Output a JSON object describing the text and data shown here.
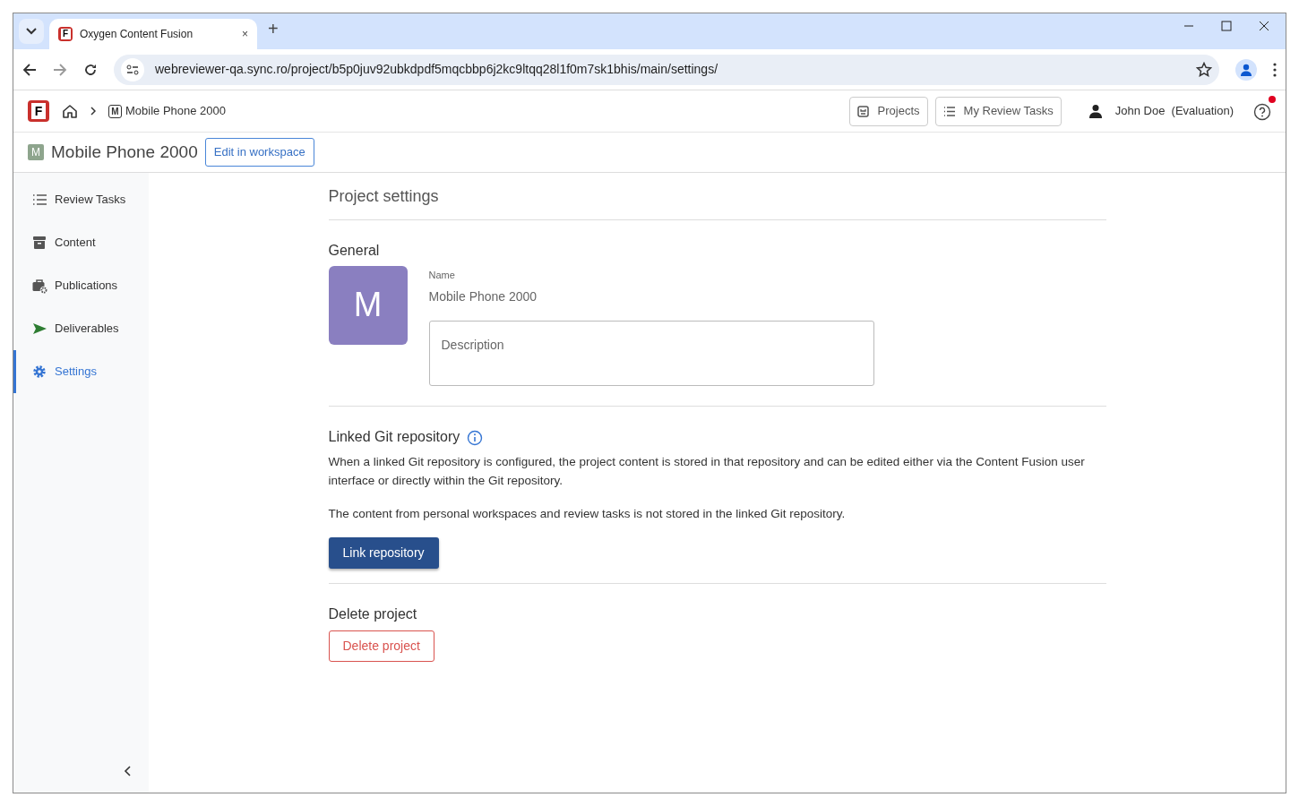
{
  "browser": {
    "tab": {
      "favicon": "F",
      "title": "Oxygen Content Fusion",
      "close": "×"
    },
    "new_tab": "+",
    "url": "webreviewer-qa.sync.ro/project/b5p0juv92ubkdpdf5mqcbbp6j2kc9ltqq28l1f0m7sk1bhis/main/settings/"
  },
  "header": {
    "logo": "F",
    "breadcrumb": [
      {
        "badge": "M",
        "label": "Mobile Phone 2000"
      }
    ],
    "buttons": [
      {
        "kind": "projects",
        "label": "Projects"
      },
      {
        "kind": "tasks",
        "label": "My Review Tasks"
      }
    ],
    "user": {
      "name": "John Doe",
      "note": "(Evaluation)"
    },
    "help": {
      "notification": true
    }
  },
  "project_bar": {
    "badge": "M",
    "title": "Mobile Phone 2000",
    "edit_button": "Edit in workspace"
  },
  "sidebar": {
    "items": [
      {
        "kind": "tasks",
        "label": "Review Tasks",
        "selected": false
      },
      {
        "kind": "content",
        "label": "Content",
        "selected": false
      },
      {
        "kind": "publications",
        "label": "Publications",
        "selected": false
      },
      {
        "kind": "deliverables",
        "label": "Deliverables",
        "selected": false
      },
      {
        "kind": "settings",
        "label": "Settings",
        "selected": true
      }
    ]
  },
  "settings": {
    "title": "Project settings",
    "general": {
      "heading": "General",
      "avatar": "M",
      "name_label": "Name",
      "name_value": "Mobile Phone 2000",
      "description_placeholder": "Description"
    },
    "git": {
      "heading": "Linked Git repository",
      "paragraphs": [
        "When a linked Git repository is configured, the project content is stored in that repository and can be edited either via the Content Fusion user interface or directly within the Git repository.",
        "The content from personal workspaces and review tasks is not stored in the linked Git repository."
      ],
      "button": "Link repository"
    },
    "delete": {
      "heading": "Delete project",
      "button": "Delete project"
    }
  }
}
